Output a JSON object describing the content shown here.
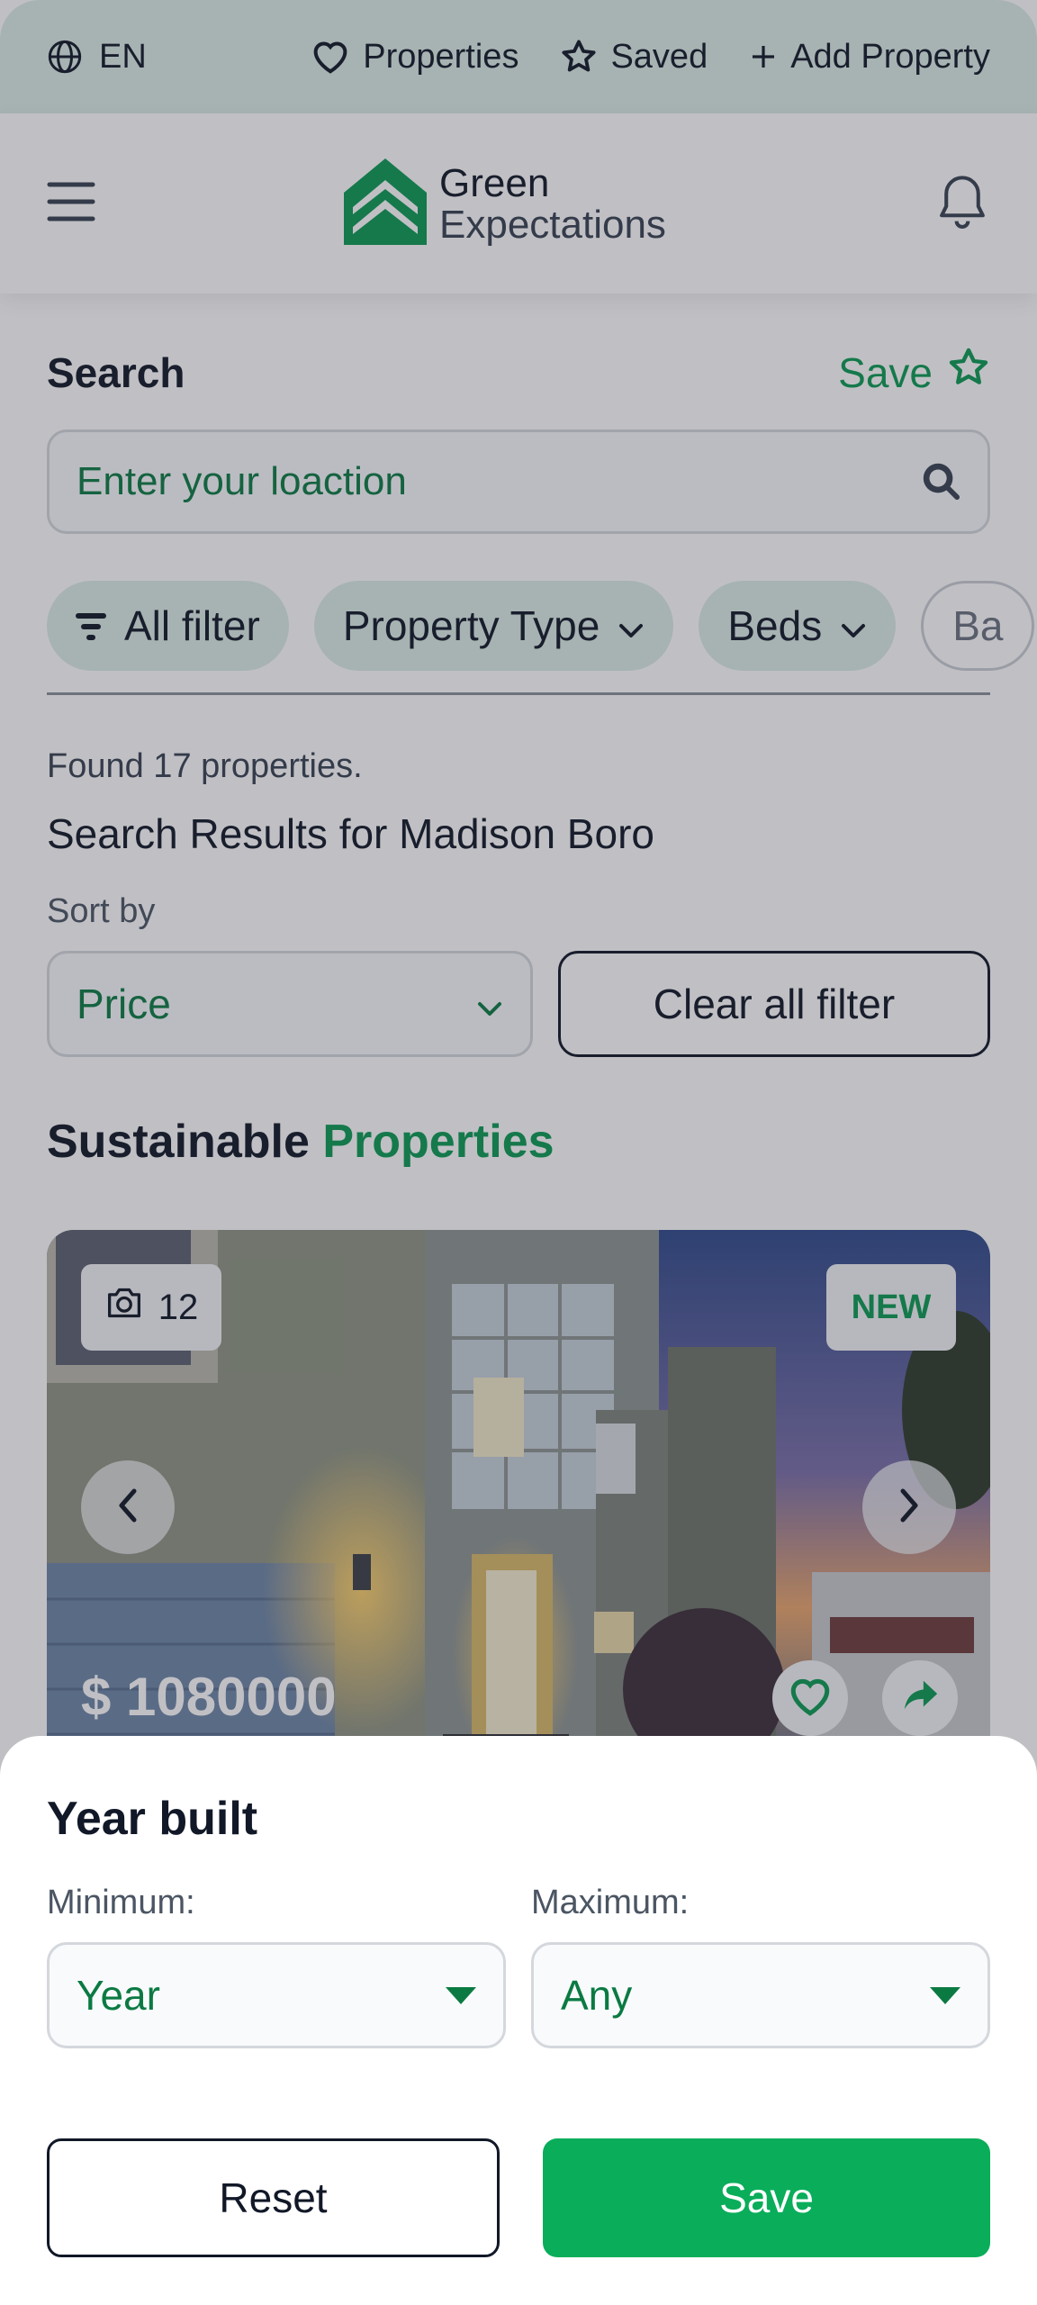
{
  "topbar": {
    "language": "EN",
    "nav": [
      {
        "label": "Properties",
        "icon": "heart-icon"
      },
      {
        "label": "Saved",
        "icon": "star-icon"
      },
      {
        "label": "Add Property",
        "icon": "plus-icon"
      }
    ]
  },
  "header": {
    "logo_line1": "Green",
    "logo_line2": "Expectations"
  },
  "search": {
    "title": "Search",
    "save_label": "Save",
    "placeholder": "Enter your loaction"
  },
  "filters": [
    {
      "label": "All filter",
      "icon": "filter-icon"
    },
    {
      "label": "Property Type",
      "icon": "chevron-down-icon"
    },
    {
      "label": "Beds",
      "icon": "chevron-down-icon"
    },
    {
      "label": "Ba",
      "icon": ""
    }
  ],
  "results": {
    "found_text": "Found 17 properties.",
    "title": "Search Results for Madison Boro",
    "sort_label": "Sort by",
    "sort_value": "Price",
    "clear_label": "Clear all filter"
  },
  "section": {
    "title_plain": "Sustainable",
    "title_accent": "Properties"
  },
  "listing": {
    "photo_count": "12",
    "badge": "NEW",
    "price": "$ 1080000"
  },
  "sheet": {
    "title": "Year built",
    "min_label": "Minimum:",
    "max_label": "Maximum:",
    "min_value": "Year",
    "max_value": "Any",
    "reset_label": "Reset",
    "save_label": "Save"
  },
  "colors": {
    "brand_green": "#0b9a52",
    "save_button": "#09ad5a",
    "topbar_bg": "#dbece5"
  }
}
